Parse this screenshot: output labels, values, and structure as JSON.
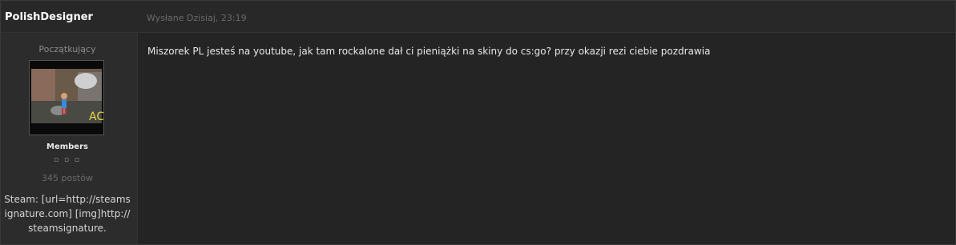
{
  "post": {
    "author": "PolishDesigner",
    "date": "Wysłane Dzisiaj, 23:19",
    "rank": "Początkujący",
    "group": "Members",
    "pips": "▫ ▫ ▫",
    "post_count": "345 postów",
    "avatar_text": "AC",
    "signature": "Steam: [url=http://steamsignature.com] [img]http://steamsignature.",
    "body": "Miszorek PL jesteś na youtube, jak tam rockalone dał ci pieniążki na skiny do cs:go? przy okazji rezi ciebie pozdrawia"
  }
}
